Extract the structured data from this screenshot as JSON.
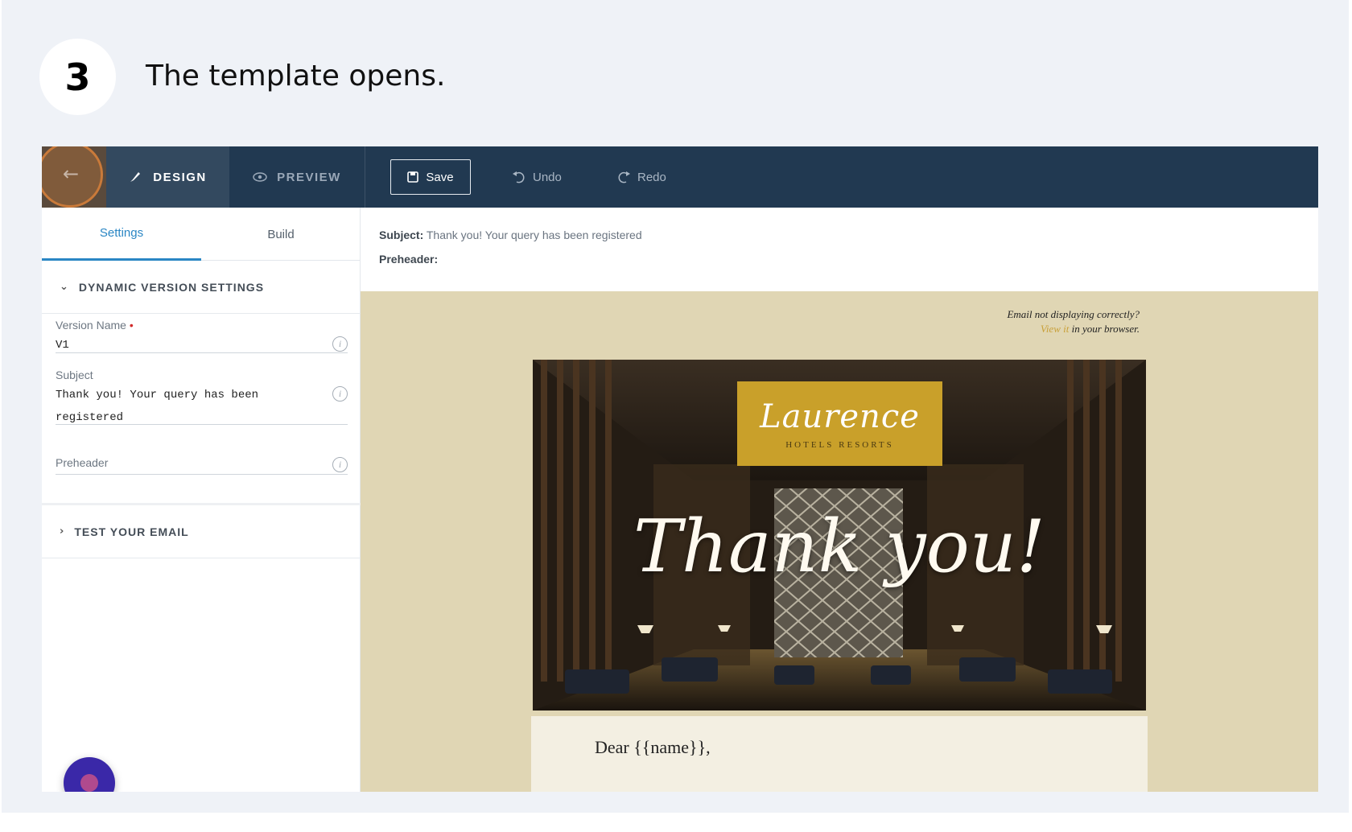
{
  "step": {
    "number": "3",
    "caption": "The template opens."
  },
  "toolbar": {
    "back_icon": "arrow-left-icon",
    "design_label": "DESIGN",
    "preview_label": "PREVIEW",
    "save_label": "Save",
    "undo_label": "Undo",
    "redo_label": "Redo"
  },
  "left_panel": {
    "tabs": [
      "Settings",
      "Build"
    ],
    "dynamic_section": "DYNAMIC VERSION SETTINGS",
    "version_name": {
      "label": "Version Name",
      "required_mark": "•",
      "value": "V1"
    },
    "subject": {
      "label": "Subject",
      "value": "Thank you! Your query has been registered"
    },
    "preheader": {
      "label": "Preheader",
      "value": ""
    },
    "test_section": "TEST YOUR EMAIL"
  },
  "preview": {
    "subject_label": "Subject:",
    "subject_value": "Thank you! Your query has been registered",
    "preheader_label": "Preheader:",
    "notice_line1": "Email not displaying correctly?",
    "notice_link": "View it",
    "notice_rest": " in your browser.",
    "logo_main": "Laurence",
    "logo_sub": "HOTELS RESORTS",
    "hero_title": "Thank you!",
    "greeting": "Dear {{name}},"
  },
  "colors": {
    "topbar": "#213951",
    "accent": "#2a86c4",
    "canvas": "#e0d6b4",
    "logo": "#c9a02a"
  }
}
